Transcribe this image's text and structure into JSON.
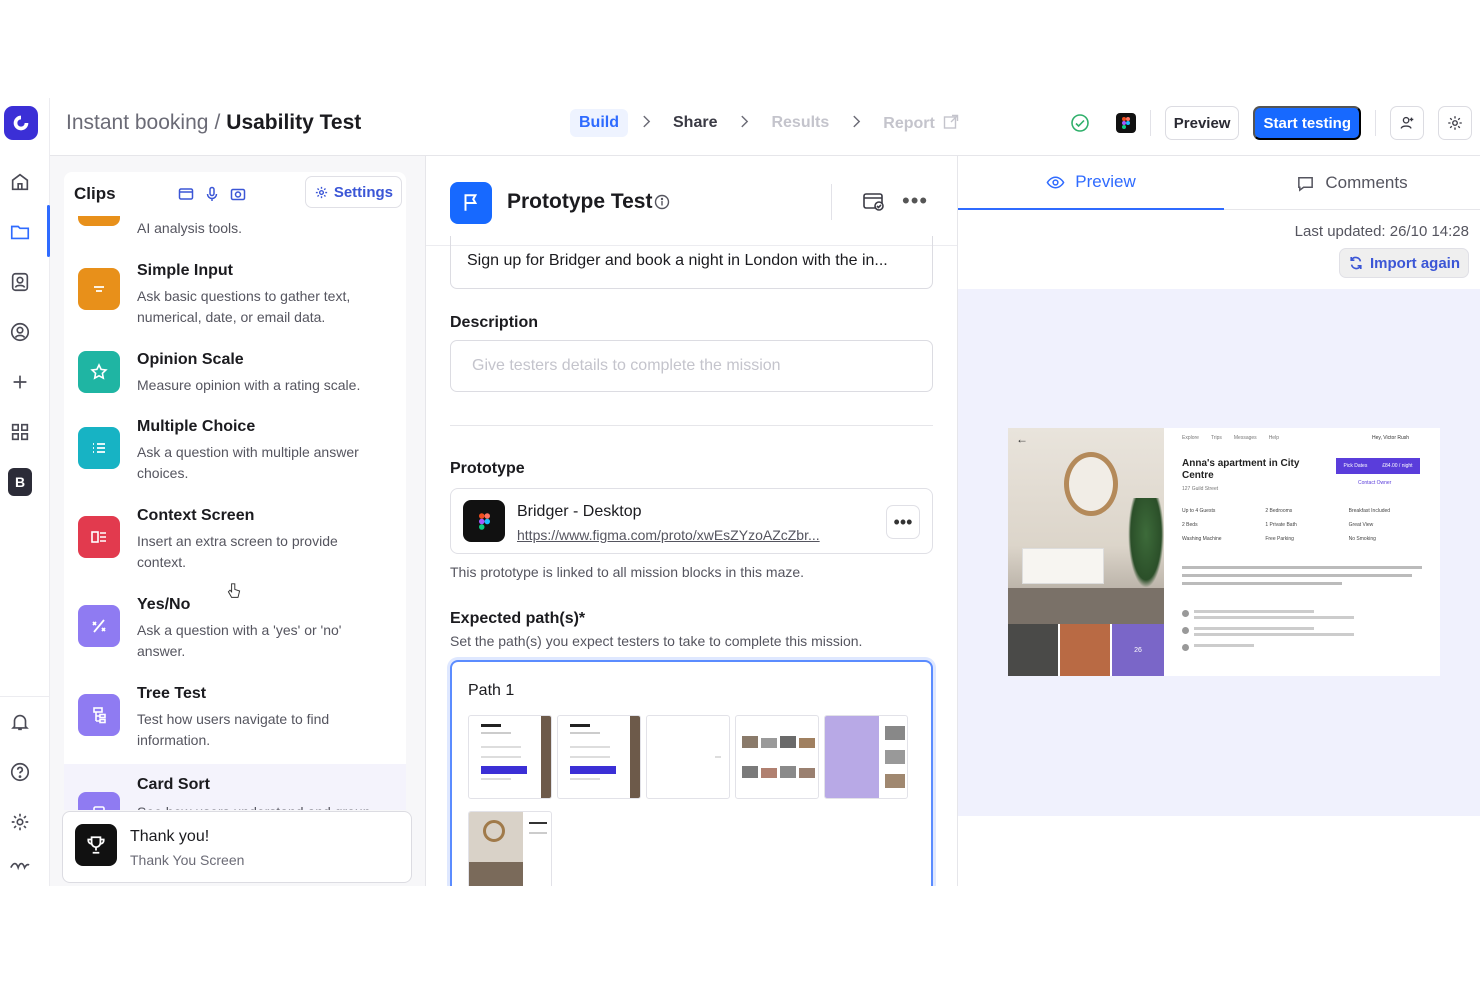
{
  "header": {
    "breadcrumb_parent": "Instant booking",
    "breadcrumb_sep": "/",
    "breadcrumb_current": "Usability Test",
    "steps": [
      {
        "label": "Build",
        "state": "active"
      },
      {
        "label": "Share",
        "state": "normal"
      },
      {
        "label": "Results",
        "state": "disabled"
      },
      {
        "label": "Report",
        "state": "disabled"
      }
    ],
    "preview_label": "Preview",
    "start_label": "Start testing"
  },
  "clips": {
    "title": "Clips",
    "settings_label": "Settings",
    "partial_desc": "AI analysis tools.",
    "items": [
      {
        "title": "Simple Input",
        "desc": "Ask basic questions to gather text, numerical, date, or email data.",
        "color": "#e8901a",
        "icon": "text-lines-icon"
      },
      {
        "title": "Opinion Scale",
        "desc": "Measure opinion with a rating scale.",
        "color": "#1fb5a3",
        "icon": "star-icon"
      },
      {
        "title": "Multiple Choice",
        "desc": "Ask a question with multiple answer choices.",
        "color": "#17b3c4",
        "icon": "list-icon"
      },
      {
        "title": "Context Screen",
        "desc": "Insert an extra screen to provide context.",
        "color": "#e23a4e",
        "icon": "context-icon"
      },
      {
        "title": "Yes/No",
        "desc": "Ask a question with a 'yes' or 'no' answer.",
        "color": "#8f7bf2",
        "icon": "percent-icon"
      },
      {
        "title": "Tree Test",
        "desc": "Test how users navigate to find information.",
        "color": "#8f7bf2",
        "icon": "tree-icon"
      },
      {
        "title": "Card Sort",
        "desc": "See how users understand and group",
        "color": "#8f7bf2",
        "icon": "card-icon"
      }
    ],
    "thanks": {
      "title": "Thank you!",
      "desc": "Thank You Screen"
    }
  },
  "block": {
    "title": "Prototype Test",
    "task_text": "Sign up for Bridger and book a night in London with the in...",
    "description_label": "Description",
    "description_placeholder": "Give testers details to complete the mission",
    "prototype_label": "Prototype",
    "prototype_name": "Bridger - Desktop",
    "prototype_url": "https://www.figma.com/proto/xwEsZYzoAZcZbr...",
    "prototype_note": "This prototype is linked to all mission blocks in this maze.",
    "paths_label": "Expected path(s)*",
    "paths_help": "Set the path(s) you expect testers to take to complete this mission.",
    "path_name": "Path 1"
  },
  "right": {
    "tab_preview": "Preview",
    "tab_comments": "Comments",
    "last_updated": "Last updated: 26/10 14:28",
    "import_label": "Import again",
    "shot": {
      "nav": [
        "Explore",
        "Trips",
        "Messages",
        "Help"
      ],
      "user": "Hey, Victor Rush",
      "title": "Anna's apartment in City Centre",
      "address": "127 Guild Street",
      "pick_dates": "Pick Dates",
      "price": "£84.00 / night",
      "contact": "Contact Owner",
      "amenities": [
        "Up to 4 Guests",
        "2 Bedrooms",
        "Breakfast Included",
        "2 Beds",
        "1 Private Bath",
        "Great View",
        "Washing Machine",
        "Free Parking",
        "No Smoking"
      ],
      "photo_count": "26"
    }
  },
  "colors": {
    "accent": "#1769ff",
    "brand": "#3b2fd6"
  }
}
